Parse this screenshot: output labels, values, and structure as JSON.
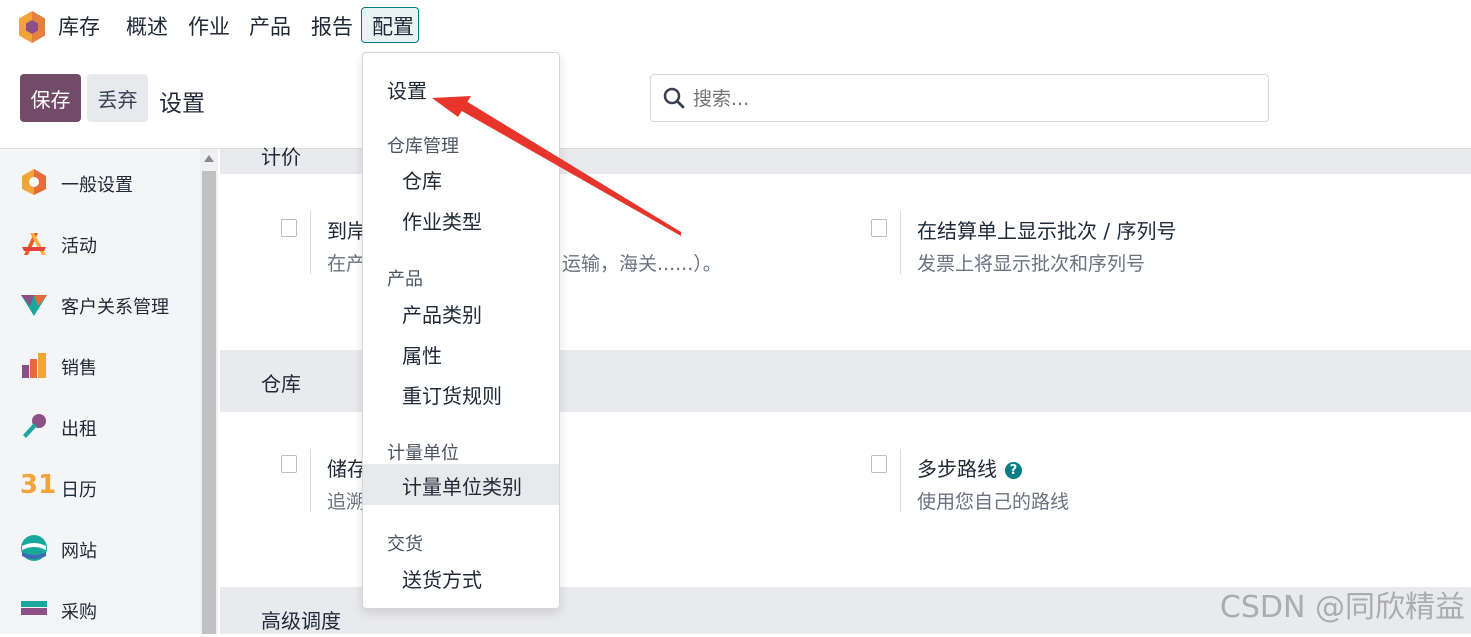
{
  "topnav": {
    "app_name": "库存",
    "menus": [
      "概述",
      "作业",
      "产品",
      "报告",
      "配置"
    ],
    "active_menu": "配置"
  },
  "control_panel": {
    "save_label": "保存",
    "discard_label": "丢弃",
    "breadcrumb": "设置",
    "search_placeholder": "搜索..."
  },
  "sidebar": {
    "items": [
      {
        "label": "一般设置",
        "icon": "general-settings-icon"
      },
      {
        "label": "活动",
        "icon": "activity-icon"
      },
      {
        "label": "客户关系管理",
        "icon": "crm-icon"
      },
      {
        "label": "销售",
        "icon": "sales-icon"
      },
      {
        "label": "出租",
        "icon": "rental-icon"
      },
      {
        "label": "日历",
        "icon": "calendar-icon",
        "icon_text": "31"
      },
      {
        "label": "网站",
        "icon": "website-icon"
      },
      {
        "label": "采购",
        "icon": "purchase-icon"
      }
    ]
  },
  "main": {
    "partial_header": "计价",
    "sections": [
      {
        "title": "仓库",
        "settings": [
          {
            "title": "储存",
            "desc": "追溯"
          },
          {
            "title": "多步路线",
            "desc": "使用您自己的路线",
            "has_help": true
          }
        ]
      },
      {
        "title": "高级调度"
      }
    ],
    "valuation_settings": [
      {
        "title": "到岸",
        "desc": "在产",
        "desc_tail": "运输，海关......）。"
      },
      {
        "title": "在结算单上显示批次 / 序列号",
        "desc": "发票上将显示批次和序列号"
      }
    ]
  },
  "dropdown": {
    "top_item": "设置",
    "groups": [
      {
        "header": "仓库管理",
        "items": [
          "仓库",
          "作业类型"
        ]
      },
      {
        "header": "产品",
        "items": [
          "产品类别",
          "属性",
          "重订货规则"
        ]
      },
      {
        "header": "计量单位",
        "items": [
          "计量单位类别"
        ],
        "highlighted": "计量单位类别"
      },
      {
        "header": "交货",
        "items": [
          "送货方式"
        ]
      }
    ]
  },
  "annotation": {
    "arrow_color": "#e8352c"
  },
  "watermark": "CSDN @同欣精益",
  "colors": {
    "primary": "#714b67",
    "accent": "#017e84"
  }
}
